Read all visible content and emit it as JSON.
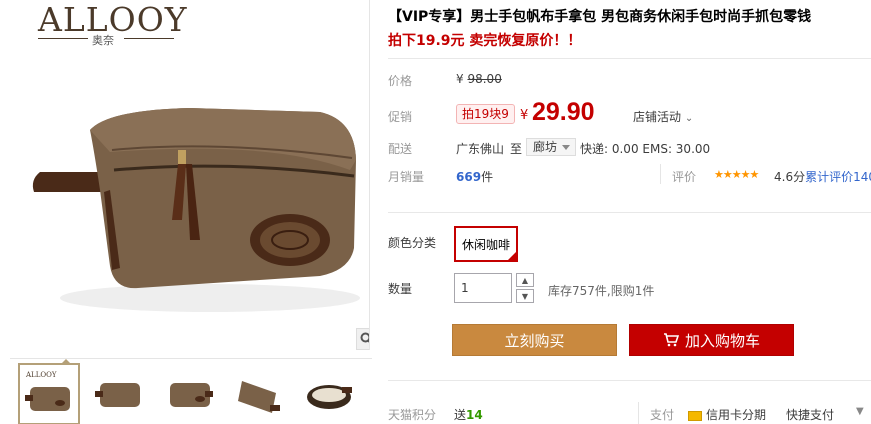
{
  "brand": {
    "logo_text": "ALLOOY",
    "logo_sub": "奥奈"
  },
  "product": {
    "title": "【VIP专享】男士手包帆布手拿包 男包商务休闲手包时尚手抓包零钱",
    "subtitle": "拍下19.9元 卖完恢复原价！！"
  },
  "price": {
    "label": "价格",
    "currency": "¥",
    "original": "98.00"
  },
  "promo": {
    "label": "促销",
    "tag": "拍19块9",
    "currency": "¥",
    "price": "29.90",
    "store_activity": "店铺活动"
  },
  "shipping": {
    "label": "配送",
    "from": "广东佛山",
    "to_word": "至",
    "destination": "廊坊",
    "fee_text": "快递: 0.00 EMS: 30.00"
  },
  "sales": {
    "label": "月销量",
    "count": "669",
    "unit": "件"
  },
  "rating": {
    "label": "评价",
    "stars": "★★★★★",
    "score": "4.6分",
    "review_text": "累计评价",
    "review_count": "140"
  },
  "color": {
    "label": "颜色分类",
    "option": "休闲咖啡"
  },
  "quantity": {
    "label": "数量",
    "value": "1",
    "stock_text": "库存757件,限购1件"
  },
  "buttons": {
    "buy_now": "立刻购买",
    "add_to_cart": "加入购物车"
  },
  "bottom": {
    "points_label": "天猫积分",
    "points_prefix": "送",
    "points_value": "14",
    "pay_label": "支付",
    "pay_credit": "信用卡分期",
    "pay_quick": "快捷支付"
  },
  "colors": {
    "accent_red": "#c40000",
    "buy_brown": "#c9893f",
    "bag_brown": "#7a6148"
  }
}
